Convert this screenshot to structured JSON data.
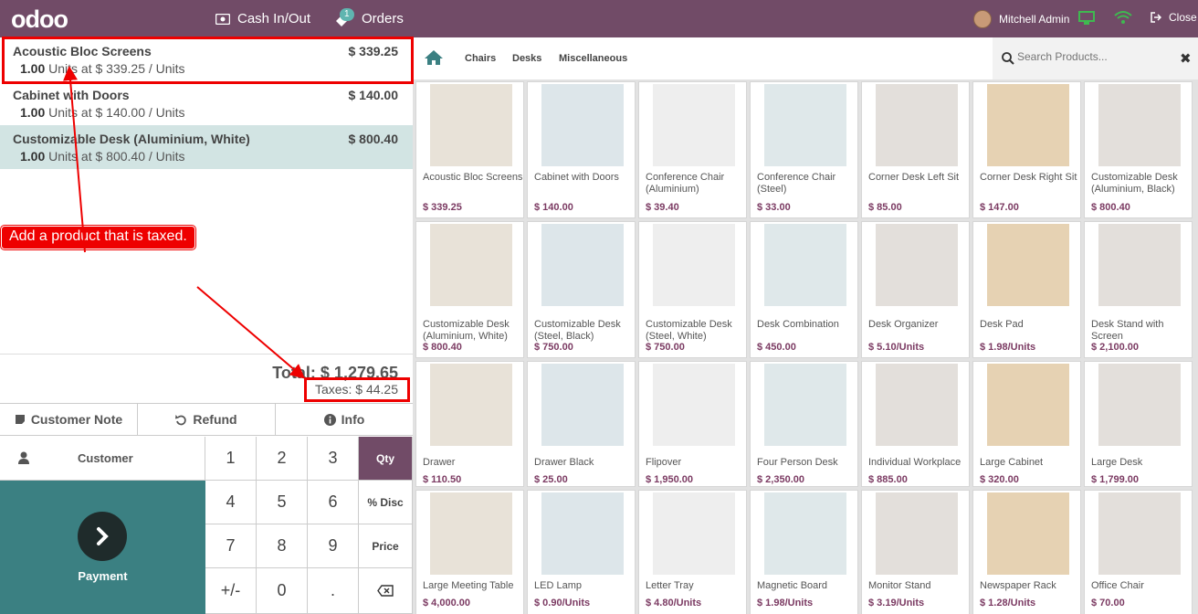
{
  "topbar": {
    "logo": "odoo",
    "cash_label": "Cash In/Out",
    "orders_label": "Orders",
    "orders_badge": "1",
    "user_name": "Mitchell Admin",
    "close_label": "Close",
    "accent": "#714b67"
  },
  "order": {
    "lines": [
      {
        "name": "Acoustic Bloc Screens",
        "price": "$ 339.25",
        "qty": "1.00",
        "info": " Units at $ 339.25 / Units"
      },
      {
        "name": "Cabinet with Doors",
        "price": "$ 140.00",
        "qty": "1.00",
        "info": " Units at $ 140.00 / Units"
      },
      {
        "name": "Customizable Desk (Aluminium, White)",
        "price": "$ 800.40",
        "qty": "1.00",
        "info": " Units at $ 800.40 / Units"
      }
    ],
    "total": "Total: $ 1,279.65",
    "taxes": "Taxes: $ 44.25"
  },
  "controls": {
    "customer_note": "Customer Note",
    "refund": "Refund",
    "info": "Info",
    "customer": "Customer",
    "payment": "Payment"
  },
  "numpad": {
    "keys": [
      "1",
      "2",
      "3",
      "4",
      "5",
      "6",
      "7",
      "8",
      "9",
      "+/-",
      "0",
      "."
    ],
    "modes": [
      "Qty",
      "% Disc",
      "Price"
    ]
  },
  "annotation": {
    "text": "Add a product that is taxed."
  },
  "categories": [
    "Chairs",
    "Desks",
    "Miscellaneous"
  ],
  "search": {
    "placeholder": "Search Products..."
  },
  "products": [
    {
      "name": "Acoustic Bloc Screens",
      "price": "$ 339.25"
    },
    {
      "name": "Cabinet with Doors",
      "price": "$ 140.00"
    },
    {
      "name": "Conference Chair (Aluminium)",
      "price": "$ 39.40"
    },
    {
      "name": "Conference Chair (Steel)",
      "price": "$ 33.00"
    },
    {
      "name": "Corner Desk Left Sit",
      "price": "$ 85.00"
    },
    {
      "name": "Corner Desk Right Sit",
      "price": "$ 147.00"
    },
    {
      "name": "Customizable Desk (Aluminium, Black)",
      "price": "$ 800.40"
    },
    {
      "name": "Customizable Desk (Aluminium, White)",
      "price": "$ 800.40"
    },
    {
      "name": "Customizable Desk (Steel, Black)",
      "price": "$ 750.00"
    },
    {
      "name": "Customizable Desk (Steel, White)",
      "price": "$ 750.00"
    },
    {
      "name": "Desk Combination",
      "price": "$ 450.00"
    },
    {
      "name": "Desk Organizer",
      "price": "$ 5.10/Units"
    },
    {
      "name": "Desk Pad",
      "price": "$ 1.98/Units"
    },
    {
      "name": "Desk Stand with Screen",
      "price": "$ 2,100.00"
    },
    {
      "name": "Drawer",
      "price": "$ 110.50"
    },
    {
      "name": "Drawer Black",
      "price": "$ 25.00"
    },
    {
      "name": "Flipover",
      "price": "$ 1,950.00"
    },
    {
      "name": "Four Person Desk",
      "price": "$ 2,350.00"
    },
    {
      "name": "Individual Workplace",
      "price": "$ 885.00"
    },
    {
      "name": "Large Cabinet",
      "price": "$ 320.00"
    },
    {
      "name": "Large Desk",
      "price": "$ 1,799.00"
    },
    {
      "name": "Large Meeting Table",
      "price": "$ 4,000.00"
    },
    {
      "name": "LED Lamp",
      "price": "$ 0.90/Units"
    },
    {
      "name": "Letter Tray",
      "price": "$ 4.80/Units"
    },
    {
      "name": "Magnetic Board",
      "price": "$ 1.98/Units"
    },
    {
      "name": "Monitor Stand",
      "price": "$ 3.19/Units"
    },
    {
      "name": "Newspaper Rack",
      "price": "$ 1.28/Units"
    },
    {
      "name": "Office Chair",
      "price": "$ 70.00"
    }
  ]
}
